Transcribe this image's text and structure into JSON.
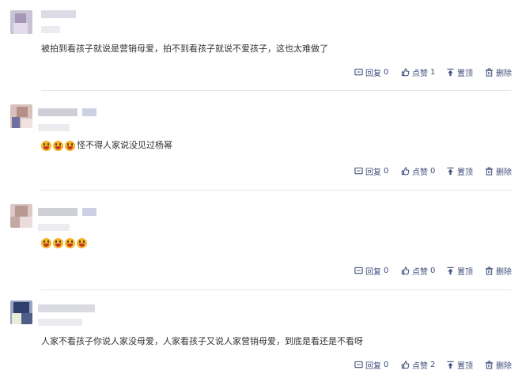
{
  "comments": [
    {
      "text": "被拍到看孩子就说是营销母爱，拍不到看孩子就说不爱孩子，这也太难做了",
      "emoji_count": 0,
      "actions": {
        "reply": "回复",
        "reply_count": "0",
        "like": "点赞",
        "like_count": "1",
        "top": "置顶",
        "delete": "删除"
      }
    },
    {
      "text": "怪不得人家说没见过杨幂",
      "emoji_count": 3,
      "actions": {
        "reply": "回复",
        "reply_count": "0",
        "like": "点赞",
        "like_count": "0",
        "top": "置顶",
        "delete": "删除"
      }
    },
    {
      "text": "",
      "emoji_count": 4,
      "actions": {
        "reply": "回复",
        "reply_count": "0",
        "like": "点赞",
        "like_count": "0",
        "top": "置顶",
        "delete": "删除"
      }
    },
    {
      "text": "人家不看孩子你说人家没母爱，人家看孩子又说人家营销母爱，到底是看还是不看呀",
      "emoji_count": 0,
      "actions": {
        "reply": "回复",
        "reply_count": "0",
        "like": "点赞",
        "like_count": "2",
        "top": "置顶",
        "delete": "删除"
      }
    }
  ],
  "icons": {
    "reply": "reply-icon",
    "like": "thumbs-up-icon",
    "top": "pin-to-top-icon",
    "delete": "trash-icon",
    "emoji": "grinning-face-icon"
  },
  "colors": {
    "action_text": "#3f4e7a",
    "body_text": "#333333",
    "divider": "#e6e6e6"
  }
}
